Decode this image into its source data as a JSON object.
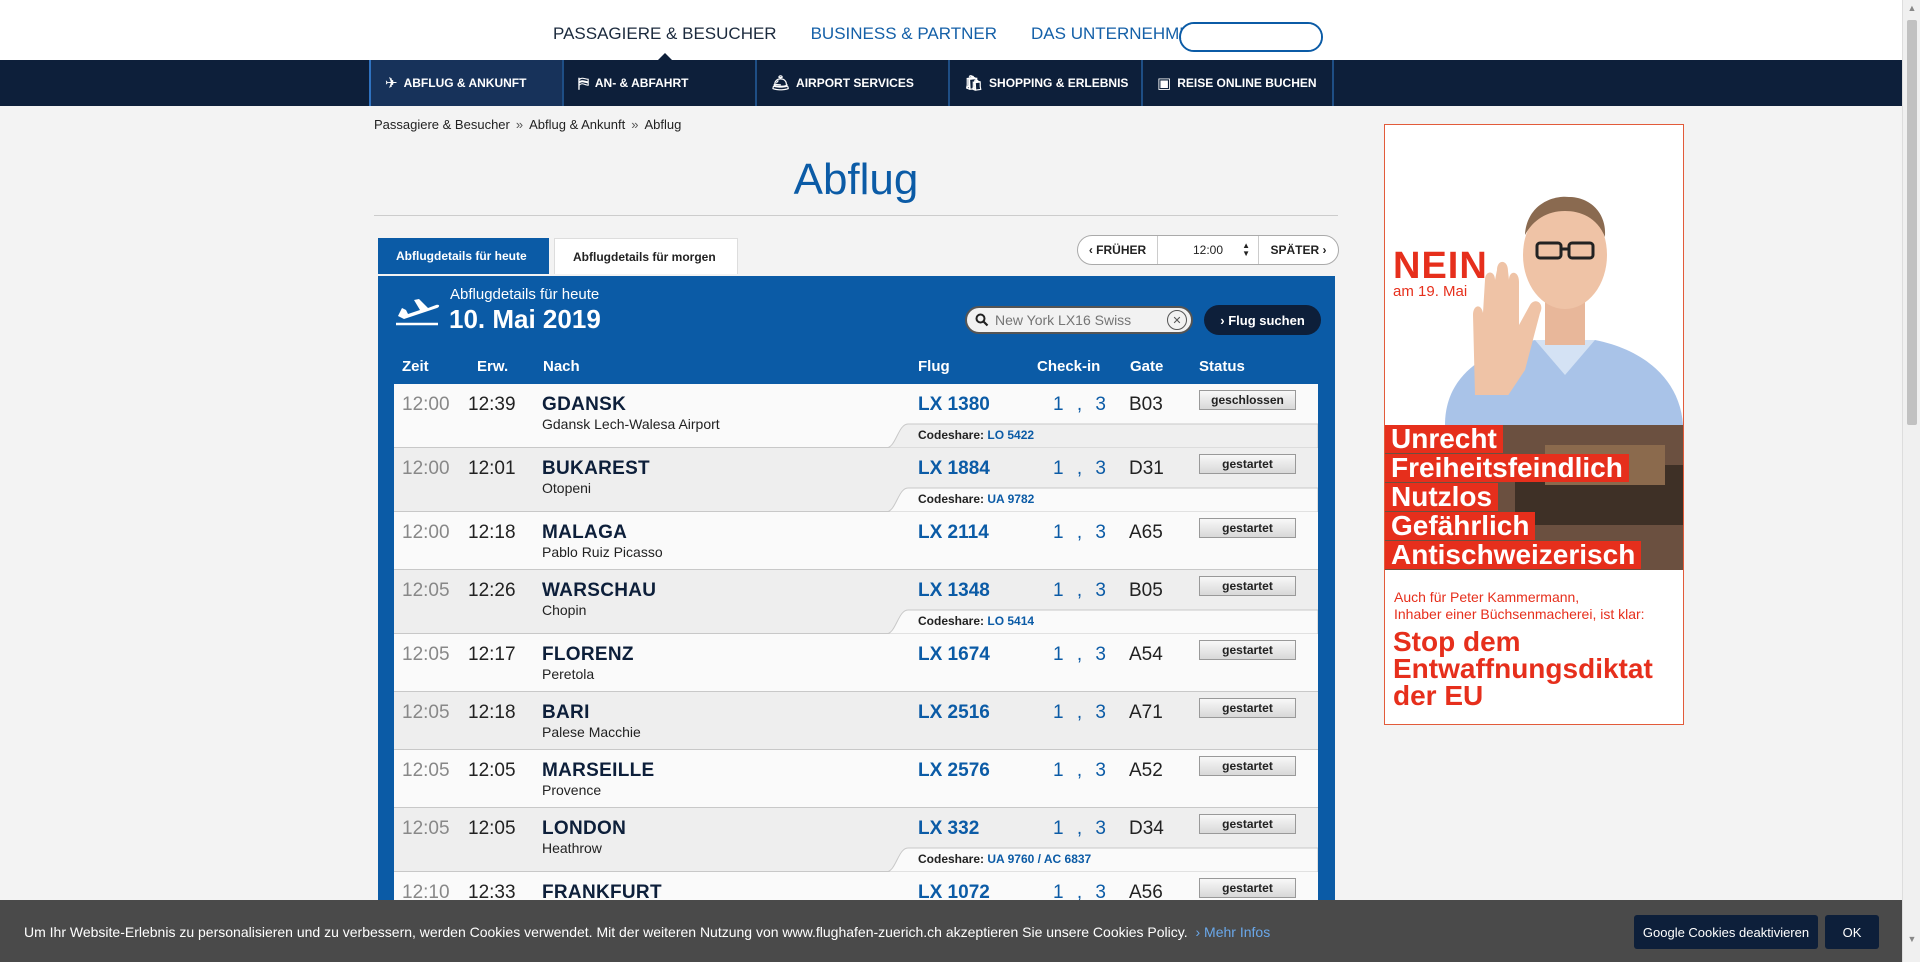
{
  "topnav": [
    {
      "label": "PASSAGIERE & BESUCHER",
      "active": true
    },
    {
      "label": "BUSINESS & PARTNER",
      "active": false
    },
    {
      "label": "DAS UNTERNEHMEN",
      "active": false
    }
  ],
  "search": {
    "placeholder": ""
  },
  "subnav": [
    {
      "label": "ABFLUG & ANKUNFT",
      "icon": "plane-icon"
    },
    {
      "label": "AN- & ABFAHRT",
      "icon": "parking-icon"
    },
    {
      "label": "AIRPORT SERVICES",
      "icon": "service-bell-icon"
    },
    {
      "label": "SHOPPING & ERLEBNIS",
      "icon": "shopping-bag-icon"
    },
    {
      "label": "REISE ONLINE BUCHEN",
      "icon": "booking-icon"
    }
  ],
  "breadcrumb": [
    "Passagiere & Besucher",
    "Abflug & Ankunft",
    "Abflug"
  ],
  "page_title": "Abflug",
  "tabs": {
    "today": "Abflugdetails für heute",
    "tomorrow": "Abflugdetails für morgen"
  },
  "timecontrol": {
    "earlier": "FRÜHER",
    "time": "12:00",
    "later": "SPÄTER"
  },
  "board": {
    "subtitle": "Abflugdetails für heute",
    "date": "10. Mai 2019",
    "search_placeholder": "New York LX16 Swiss",
    "search_button": "Flug suchen",
    "columns": {
      "zeit": "Zeit",
      "erw": "Erw.",
      "nach": "Nach",
      "flug": "Flug",
      "checkin": "Check-in",
      "gate": "Gate",
      "status": "Status"
    },
    "codeshare_label": "Codeshare:",
    "flights": [
      {
        "zeit": "12:00",
        "erw": "12:39",
        "nach": "GDANSK",
        "airport": "Gdansk Lech-Walesa Airport",
        "flug": "LX 1380",
        "checkin": "1 , 3",
        "gate": "B03",
        "status": "geschlossen",
        "codeshare": "LO 5422"
      },
      {
        "zeit": "12:00",
        "erw": "12:01",
        "nach": "BUKAREST",
        "airport": "Otopeni",
        "flug": "LX 1884",
        "checkin": "1 , 3",
        "gate": "D31",
        "status": "gestartet",
        "codeshare": "UA 9782"
      },
      {
        "zeit": "12:00",
        "erw": "12:18",
        "nach": "MALAGA",
        "airport": "Pablo Ruiz Picasso",
        "flug": "LX 2114",
        "checkin": "1 , 3",
        "gate": "A65",
        "status": "gestartet",
        "codeshare": ""
      },
      {
        "zeit": "12:05",
        "erw": "12:26",
        "nach": "WARSCHAU",
        "airport": "Chopin",
        "flug": "LX 1348",
        "checkin": "1 , 3",
        "gate": "B05",
        "status": "gestartet",
        "codeshare": "LO 5414"
      },
      {
        "zeit": "12:05",
        "erw": "12:17",
        "nach": "FLORENZ",
        "airport": "Peretola",
        "flug": "LX 1674",
        "checkin": "1 , 3",
        "gate": "A54",
        "status": "gestartet",
        "codeshare": ""
      },
      {
        "zeit": "12:05",
        "erw": "12:18",
        "nach": "BARI",
        "airport": "Palese Macchie",
        "flug": "LX 2516",
        "checkin": "1 , 3",
        "gate": "A71",
        "status": "gestartet",
        "codeshare": ""
      },
      {
        "zeit": "12:05",
        "erw": "12:05",
        "nach": "MARSEILLE",
        "airport": "Provence",
        "flug": "LX 2576",
        "checkin": "1 , 3",
        "gate": "A52",
        "status": "gestartet",
        "codeshare": ""
      },
      {
        "zeit": "12:05",
        "erw": "12:05",
        "nach": "LONDON",
        "airport": "Heathrow",
        "flug": "LX 332",
        "checkin": "1 , 3",
        "gate": "D34",
        "status": "gestartet",
        "codeshare": "UA 9760 / AC 6837"
      },
      {
        "zeit": "12:10",
        "erw": "12:33",
        "nach": "FRANKFURT",
        "airport": "",
        "flug": "LX 1072",
        "checkin": "1 , 3",
        "gate": "A56",
        "status": "gestartet",
        "codeshare": ""
      }
    ]
  },
  "ad": {
    "nein": "NEIN",
    "date": "am 19. Mai",
    "words": [
      "Unrecht",
      "Freiheitsfeindlich",
      "Nutzlos",
      "Gefährlich",
      "Antischweizerisch"
    ],
    "sub_line1": "Auch für Peter Kammermann,",
    "sub_line2": "Inhaber einer Büchsenmacherei, ist klar:",
    "cta_line1": "Stop dem",
    "cta_line2": "Entwaffnungsdiktat",
    "cta_line3": "der EU",
    "accent_color": "#e62f1c"
  },
  "cookie": {
    "text": "Um Ihr Website-Erlebnis zu personalisieren und zu verbessern, werden Cookies verwendet. Mit der weiteren Nutzung von www.flughafen-zuerich.ch akzeptieren Sie unsere Cookies Policy.",
    "more": "› Mehr Infos",
    "deactivate": "Google Cookies deaktivieren",
    "ok": "OK"
  },
  "colors": {
    "primary": "#0b5ba6",
    "dark_navy": "#0d1f3a"
  }
}
